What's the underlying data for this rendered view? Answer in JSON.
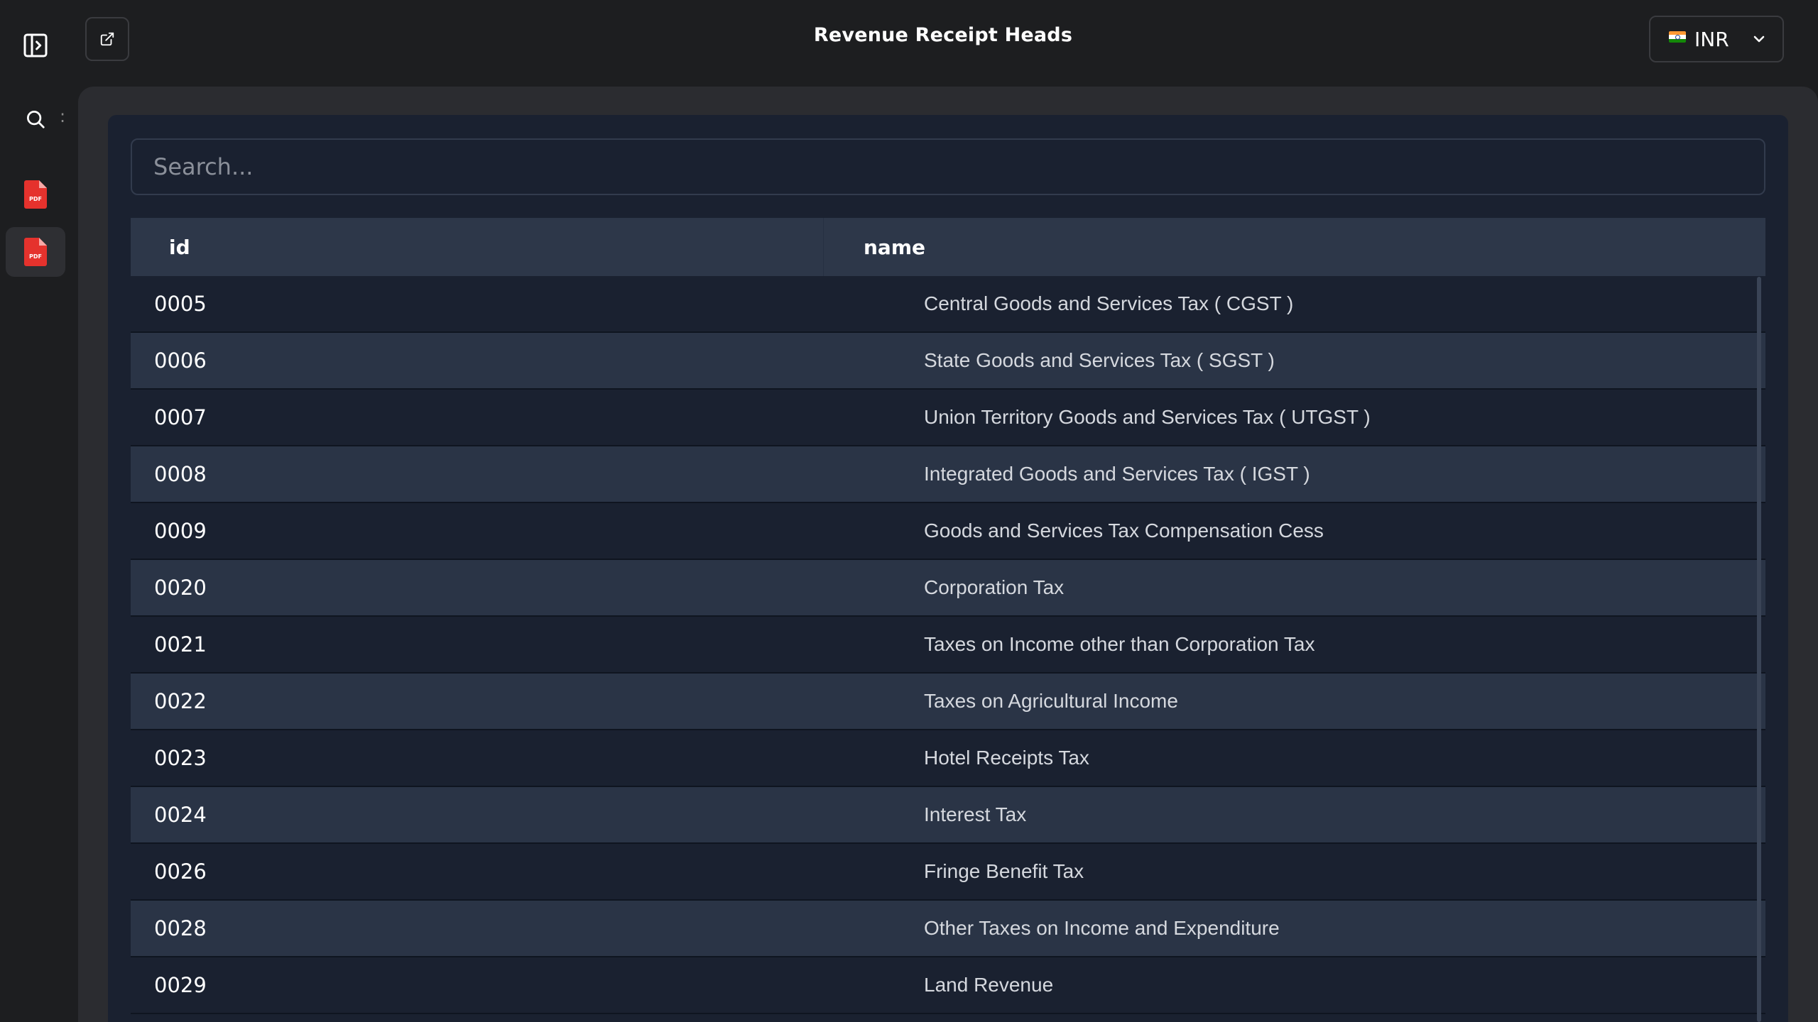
{
  "header": {
    "title": "Revenue Receipt Heads",
    "currency": "INR"
  },
  "icons": {
    "sidebar_toggle": "sidebar-toggle-icon",
    "search": "search-icon",
    "pdf": "pdf-file-icon",
    "popout": "external-link-icon",
    "dropdown": "chevron-down-icon",
    "flag": "india-flag-icon"
  },
  "colors": {
    "background": "#1d1e20",
    "panel": "#2b2c30",
    "table_bg": "#1a2130",
    "row_alt": "#2a3446",
    "header_row": "#2d3749",
    "pdf_red": "#e5322d"
  },
  "sidebar": {
    "colon": ":"
  },
  "search": {
    "placeholder": "Search..."
  },
  "table": {
    "columns": [
      "id",
      "name"
    ],
    "rows": [
      {
        "id": "0005",
        "name": "Central Goods and Services Tax ( CGST )"
      },
      {
        "id": "0006",
        "name": "State Goods and Services Tax ( SGST )"
      },
      {
        "id": "0007",
        "name": "Union Territory Goods and Services Tax ( UTGST )"
      },
      {
        "id": "0008",
        "name": "Integrated Goods and Services Tax ( IGST )"
      },
      {
        "id": "0009",
        "name": "Goods and Services Tax Compensation Cess"
      },
      {
        "id": "0020",
        "name": "Corporation Tax"
      },
      {
        "id": "0021",
        "name": "Taxes on Income other than Corporation Tax"
      },
      {
        "id": "0022",
        "name": "Taxes on Agricultural Income"
      },
      {
        "id": "0023",
        "name": "Hotel Receipts Tax"
      },
      {
        "id": "0024",
        "name": "Interest Tax"
      },
      {
        "id": "0026",
        "name": "Fringe Benefit Tax"
      },
      {
        "id": "0028",
        "name": "Other Taxes on Income and Expenditure"
      },
      {
        "id": "0029",
        "name": "Land Revenue"
      }
    ]
  }
}
